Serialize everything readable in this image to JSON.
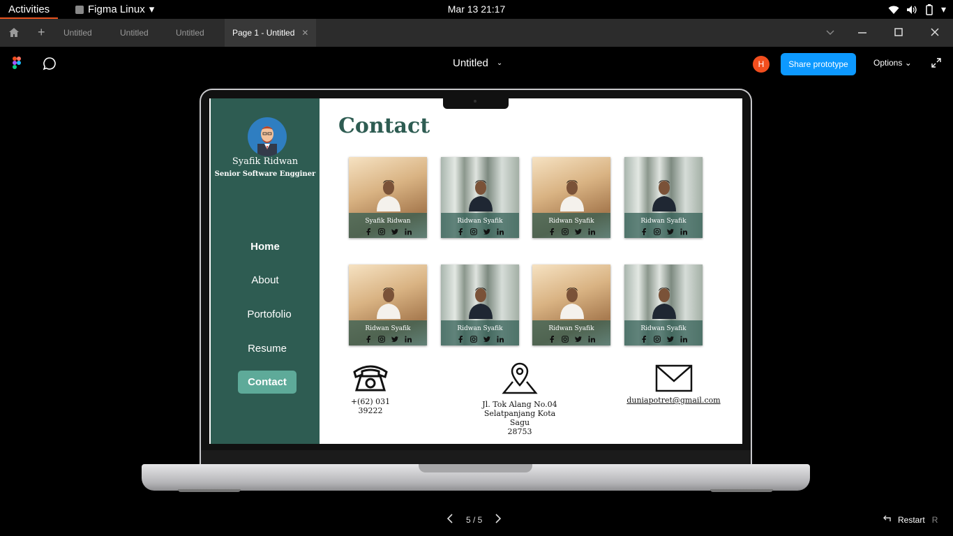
{
  "system": {
    "activities": "Activities",
    "app_name": "Figma Linux",
    "clock": "Mar 13  21:17"
  },
  "tabs": [
    {
      "label": "Untitled"
    },
    {
      "label": "Untitled"
    },
    {
      "label": "Untitled"
    },
    {
      "label": "Page 1 - Untitled",
      "active": true
    }
  ],
  "toolbar": {
    "doc_title": "Untitled",
    "avatar_initial": "H",
    "share_label": "Share prototype",
    "options_label": "Options"
  },
  "portfolio": {
    "name": "Syafik Ridwan",
    "role": "Senior Software Engginer",
    "nav": [
      "Home",
      "About",
      "Portofolio",
      "Resume",
      "Contact"
    ],
    "active_nav": "Contact",
    "page_title": "Contact",
    "cards": [
      {
        "name": "Syafik Ridwan",
        "photo": "warm"
      },
      {
        "name": "Ridwan Syafik",
        "photo": "forest"
      },
      {
        "name": "Ridwan Syafik",
        "photo": "warm"
      },
      {
        "name": "Ridwan Syafik",
        "photo": "forest"
      },
      {
        "name": "Ridwan Syafik",
        "photo": "warm"
      },
      {
        "name": "Ridwan Syafik",
        "photo": "forest"
      },
      {
        "name": "Ridwan Syafik",
        "photo": "warm"
      },
      {
        "name": "Ridwan Syafik",
        "photo": "forest"
      }
    ],
    "social_icons": [
      "facebook-icon",
      "instagram-icon",
      "twitter-icon",
      "linkedin-icon"
    ],
    "phone": "+(62) 031 39222",
    "address_line1": "Jl. Tok Alang No.04",
    "address_line2": "Selatpanjang Kota Sagu",
    "address_line3": "28753",
    "email": "duniapotret@gmail.com"
  },
  "prototype_nav": {
    "page_indicator": "5 / 5",
    "restart_label": "Restart",
    "restart_key": "R"
  },
  "colors": {
    "sidebar": "#2e5c52",
    "accent_button": "#5eaa99",
    "share_button": "#0d99ff"
  }
}
